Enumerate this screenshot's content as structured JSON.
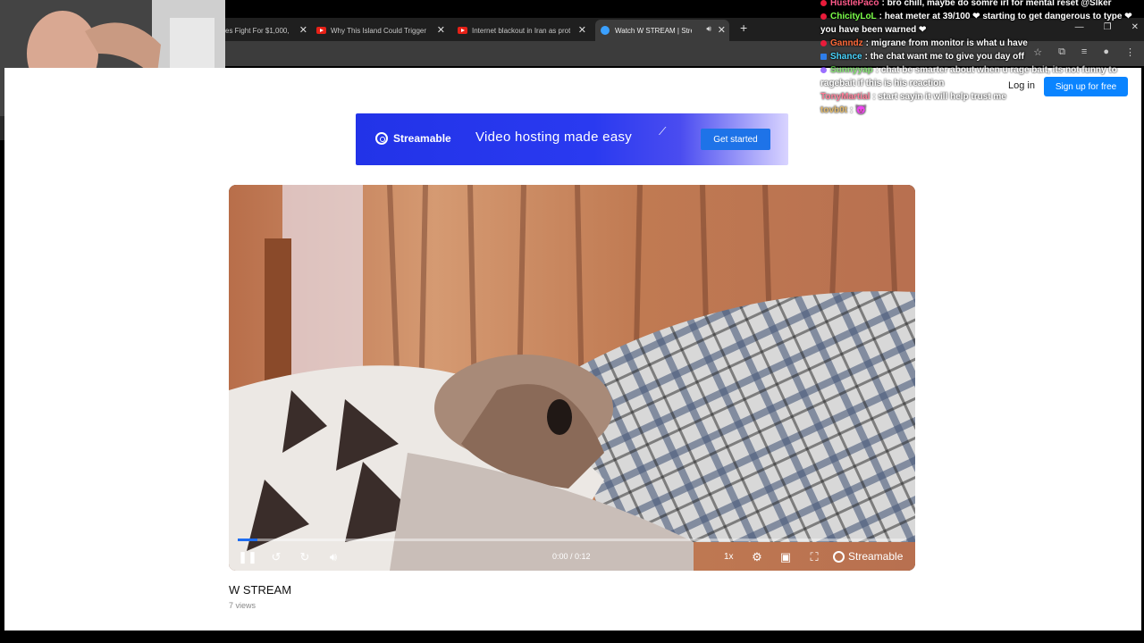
{
  "browser": {
    "tabs": [
      {
        "title": "es Fight For $1,000,",
        "icon": "youtube-icon"
      },
      {
        "title": "Why This Island Could Trigger W",
        "icon": "youtube-icon"
      },
      {
        "title": "Internet blackout in Iran as prot",
        "icon": "youtube-icon"
      },
      {
        "title": "Watch W STREAM | Streamable",
        "icon": "streamable-icon",
        "active": true
      }
    ],
    "new_tab": "+"
  },
  "page": {
    "login": "Log in",
    "signup": "Sign up for free",
    "ad": {
      "brand": "Streamable",
      "tagline": "Video hosting made easy",
      "cta": "Get started"
    },
    "player": {
      "time": "0:00 / 0:12",
      "progress": 0.03,
      "speed": "1x",
      "brand": "Streamable"
    },
    "video_title": "W STREAM",
    "views": "7 views"
  },
  "chat": [
    {
      "user": "HustlePaco",
      "color": "#ff5a8a",
      "text": "bro chill, maybe do somre irl for mental reset @Slker",
      "badge": "#e81b3a"
    },
    {
      "user": "ChicityLoL",
      "color": "#7cff4a",
      "text": "heat meter at 39/100 ❤ starting to get dangerous to type ❤ you have been warned ❤",
      "badge": "#e81b3a"
    },
    {
      "user": "Ganndz",
      "color": "#ff6a3a",
      "text": "migrane from monitor is what u have",
      "badge": "#e81b3a"
    },
    {
      "user": "Shance",
      "color": "#4ad6ff",
      "text": "the chat want me to give you day off",
      "badge": "#2e7de9"
    },
    {
      "user": "Sunnyyap",
      "color": "#5fdc46",
      "text": "chat be smarter about when u rage bait, its not funny to ragebait if this is his reaction",
      "badge": "#7a3fff"
    },
    {
      "user": "TonyMartial",
      "color": "#ff5577",
      "text": "start sayin it will help trust me",
      "badge": ""
    },
    {
      "user": "tovb0t",
      "color": "#d8a23a",
      "text": "😈",
      "badge": ""
    }
  ],
  "colors": {
    "accent": "#0a84ff",
    "progress": "#1e6df0"
  }
}
